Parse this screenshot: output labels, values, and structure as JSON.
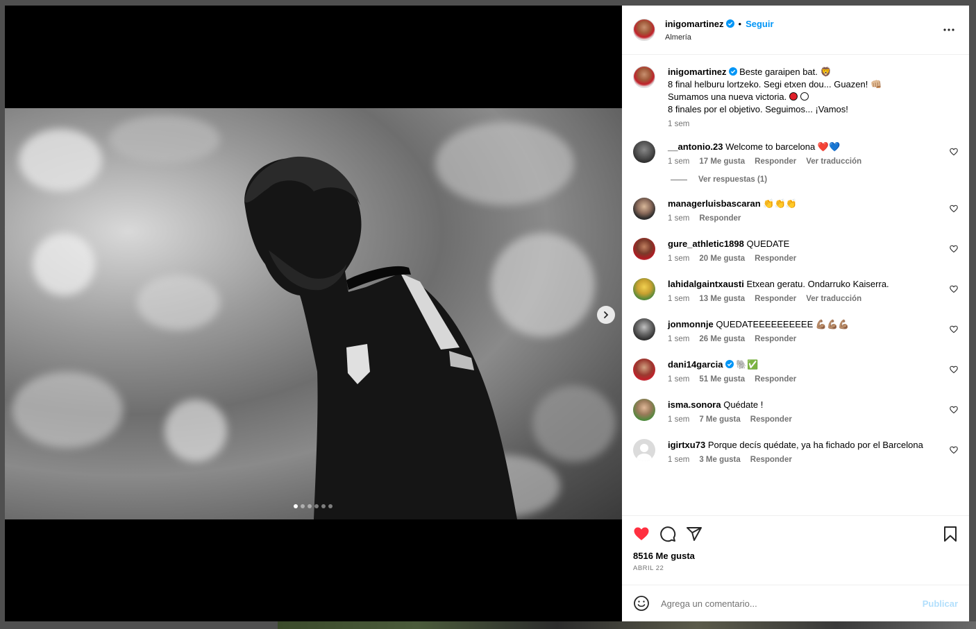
{
  "post": {
    "author": "inigomartinez",
    "follow_label": "Seguir",
    "separator": "•",
    "location": "Almería",
    "likes": "8516 Me gusta",
    "date": "ABRIL 22",
    "comment_placeholder": "Agrega un comentario...",
    "publish_label": "Publicar",
    "carousel_count": 6,
    "carousel_active": 0
  },
  "caption": {
    "username": "inigomartinez",
    "lines": [
      "Beste garaipen bat. 🦁",
      "8 final helburu lortzeko. Segi etxen dou... Guazen! 👊🏼",
      "Sumamos una nueva victoria.",
      "8 finales por el objetivo. Seguimos... ¡Vamos!"
    ],
    "time": "1 sem"
  },
  "comments": [
    {
      "username": "__antonio.23",
      "text": "Welcome to barcelona",
      "emoji": "❤️💙",
      "time": "1 sem",
      "likes": "17 Me gusta",
      "reply": "Responder",
      "translate": "Ver traducción",
      "avatar": "gray"
    },
    {
      "username": "managerluisbascaran",
      "text": "",
      "emoji": "👏👏👏",
      "time": "1 sem",
      "likes": "",
      "reply": "Responder",
      "translate": "",
      "avatar": "bald"
    },
    {
      "username": "gure_athletic1898",
      "text": "QUEDATE",
      "emoji": "",
      "time": "1 sem",
      "likes": "20 Me gusta",
      "reply": "Responder",
      "translate": "",
      "avatar": "red"
    },
    {
      "username": "lahidalgaintxausti",
      "text": "Etxean geratu. Ondarruko Kaiserra.",
      "emoji": "",
      "time": "1 sem",
      "likes": "13 Me gusta",
      "reply": "Responder",
      "translate": "Ver traducción",
      "avatar": "yellow"
    },
    {
      "username": "jonmonnje",
      "text": "QUEDATEEEEEEEEEE",
      "emoji": "💪🏽💪🏽💪🏽",
      "time": "1 sem",
      "likes": "26 Me gusta",
      "reply": "Responder",
      "translate": "",
      "avatar": "dark"
    },
    {
      "username": "dani14garcia",
      "text": "",
      "emoji": "🐘✅",
      "time": "1 sem",
      "likes": "51 Me gusta",
      "reply": "Responder",
      "translate": "",
      "avatar": "team"
    },
    {
      "username": "isma.sonora",
      "text": "Quédate !",
      "emoji": "",
      "time": "1 sem",
      "likes": "7 Me gusta",
      "reply": "Responder",
      "translate": "",
      "avatar": "boy"
    },
    {
      "username": "igirtxu73",
      "text": "Porque decís quédate, ya ha fichado por el Barcelona",
      "emoji": "",
      "time": "1 sem",
      "likes": "3 Me gusta",
      "reply": "Responder",
      "translate": "",
      "avatar": "empty"
    }
  ],
  "view_replies": "Ver respuestas (1)",
  "colors": {
    "accent": "#0095f6",
    "like_red": "#ff3040",
    "muted": "#737373"
  }
}
